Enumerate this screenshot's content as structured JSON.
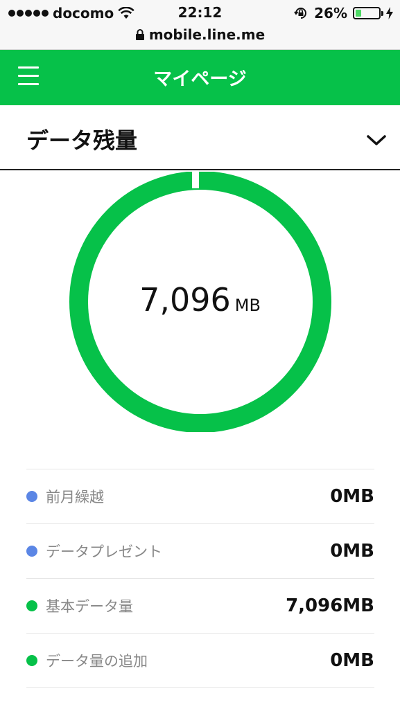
{
  "status_bar": {
    "carrier": "docomo",
    "time": "22:12",
    "battery_percent": "26%",
    "battery_level": 0.26,
    "url": "mobile.line.me"
  },
  "app_bar": {
    "title": "マイページ",
    "color": "#06c149"
  },
  "section": {
    "title": "データ残量"
  },
  "gauge": {
    "value": "7,096",
    "unit": "MB",
    "ring_color": "#06c149"
  },
  "breakdown": [
    {
      "label": "前月繰越",
      "value": "0MB",
      "color": "#5b86e5"
    },
    {
      "label": "データプレゼント",
      "value": "0MB",
      "color": "#5b86e5"
    },
    {
      "label": "基本データ量",
      "value": "7,096MB",
      "color": "#06c149"
    },
    {
      "label": "データ量の追加",
      "value": "0MB",
      "color": "#06c149"
    }
  ]
}
